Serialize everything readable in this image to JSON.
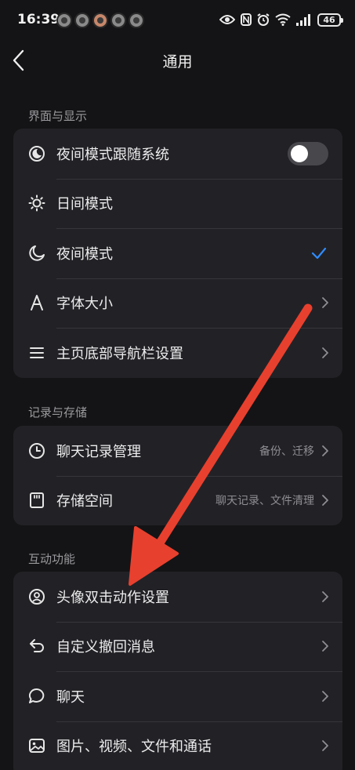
{
  "status_bar": {
    "time": "16:39",
    "battery": "46"
  },
  "header": {
    "title": "通用",
    "back_icon": "chevron-left-icon"
  },
  "sections": [
    {
      "title": "界面与显示",
      "items": [
        {
          "label": "夜间模式跟随系统",
          "icon": "night-mode-follow-icon",
          "control": "toggle",
          "toggle_on": false
        },
        {
          "label": "日间模式",
          "icon": "sun-icon",
          "control": "none"
        },
        {
          "label": "夜间模式",
          "icon": "moon-icon",
          "control": "check",
          "selected": true
        },
        {
          "label": "字体大小",
          "icon": "font-size-icon",
          "control": "chevron"
        },
        {
          "label": "主页底部导航栏设置",
          "icon": "menu-icon",
          "control": "chevron"
        }
      ]
    },
    {
      "title": "记录与存储",
      "items": [
        {
          "label": "聊天记录管理",
          "icon": "clock-icon",
          "value": "备份、迁移",
          "control": "chevron"
        },
        {
          "label": "存储空间",
          "icon": "storage-card-icon",
          "value": "聊天记录、文件清理",
          "control": "chevron"
        }
      ]
    },
    {
      "title": "互动功能",
      "items": [
        {
          "label": "头像双击动作设置",
          "icon": "avatar-icon",
          "control": "chevron"
        },
        {
          "label": "自定义撤回消息",
          "icon": "undo-icon",
          "control": "chevron"
        },
        {
          "label": "聊天",
          "icon": "chat-bubble-icon",
          "control": "chevron"
        },
        {
          "label": "图片、视频、文件和通话",
          "icon": "image-icon",
          "control": "chevron"
        }
      ]
    }
  ],
  "colors": {
    "background": "#141416",
    "card": "#222226",
    "accent": "#2f8cff",
    "annotation": "#e8402e"
  }
}
